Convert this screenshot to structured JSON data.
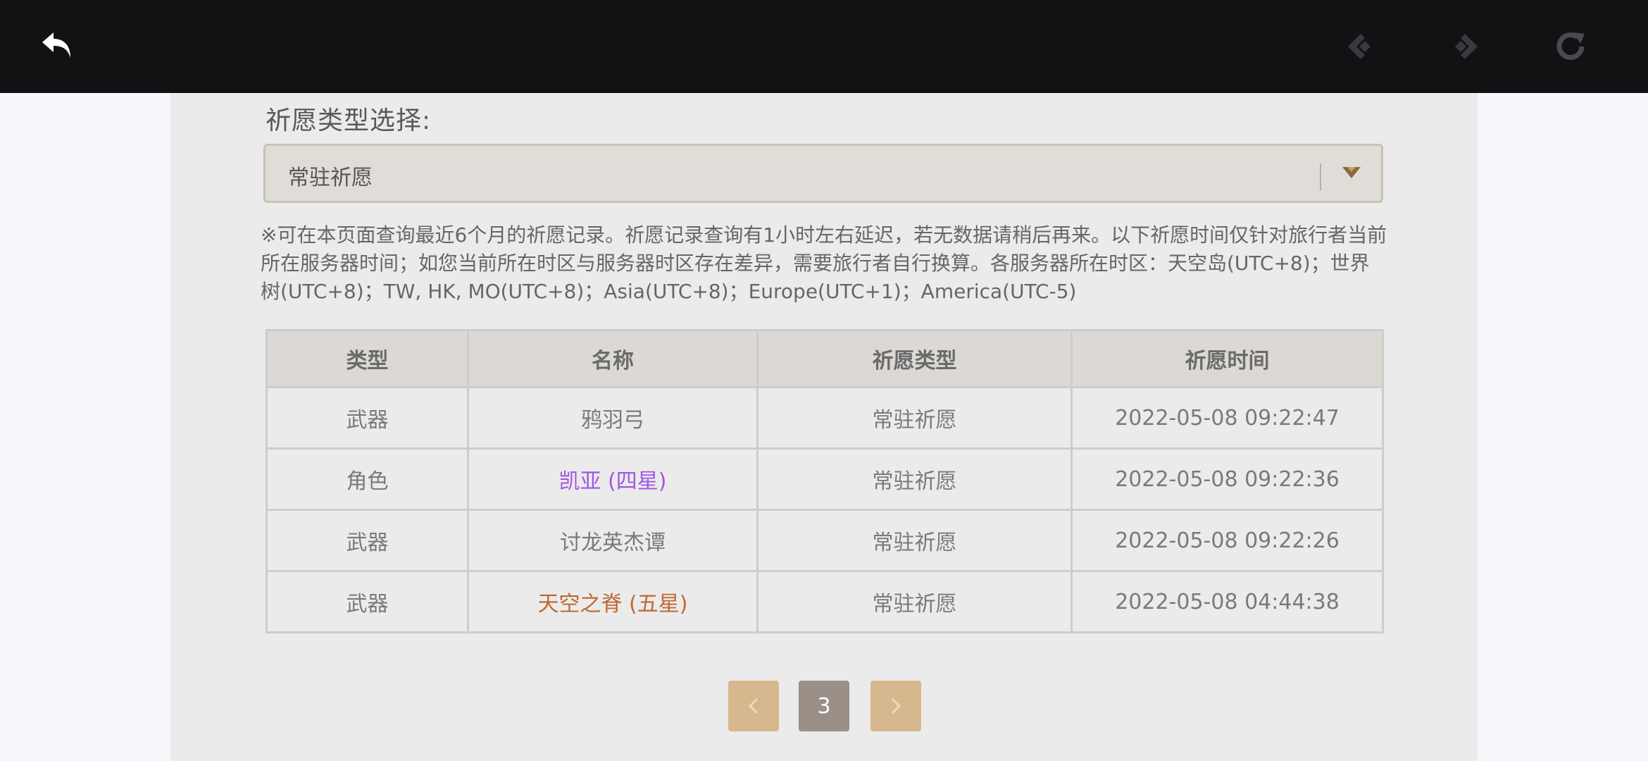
{
  "topbar": {
    "back_icon": "back-arrow-icon",
    "prev_icon": "diamond-back-icon",
    "next_icon": "diamond-forward-icon",
    "refresh_icon": "refresh-icon"
  },
  "filter": {
    "label": "祈愿类型选择:",
    "selected": "常驻祈愿"
  },
  "notice": "※可在本页面查询最近6个月的祈愿记录。祈愿记录查询有1小时左右延迟，若无数据请稍后再来。以下祈愿时间仅针对旅行者当前所在服务器时间；如您当前所在时区与服务器时区存在差异，需要旅行者自行换算。各服务器所在时区：天空岛(UTC+8)；世界树(UTC+8)；TW, HK, MO(UTC+8)；Asia(UTC+8)；Europe(UTC+1)；America(UTC-5)",
  "table": {
    "headers": [
      "类型",
      "名称",
      "祈愿类型",
      "祈愿时间"
    ],
    "rows": [
      {
        "type": "武器",
        "name": "鸦羽弓",
        "wish": "常驻祈愿",
        "time": "2022-05-08 09:22:47",
        "color": "#7a7a7a"
      },
      {
        "type": "角色",
        "name": "凯亚 (四星)",
        "wish": "常驻祈愿",
        "time": "2022-05-08 09:22:36",
        "color": "#a256e1"
      },
      {
        "type": "武器",
        "name": "讨龙英杰谭",
        "wish": "常驻祈愿",
        "time": "2022-05-08 09:22:26",
        "color": "#7a7a7a"
      },
      {
        "type": "武器",
        "name": "天空之脊 (五星)",
        "wish": "常驻祈愿",
        "time": "2022-05-08 04:44:38",
        "color": "#bd6932"
      }
    ]
  },
  "pagination": {
    "prev_icon": "chevron-left-icon",
    "current_page": "3",
    "next_icon": "chevron-right-icon"
  }
}
